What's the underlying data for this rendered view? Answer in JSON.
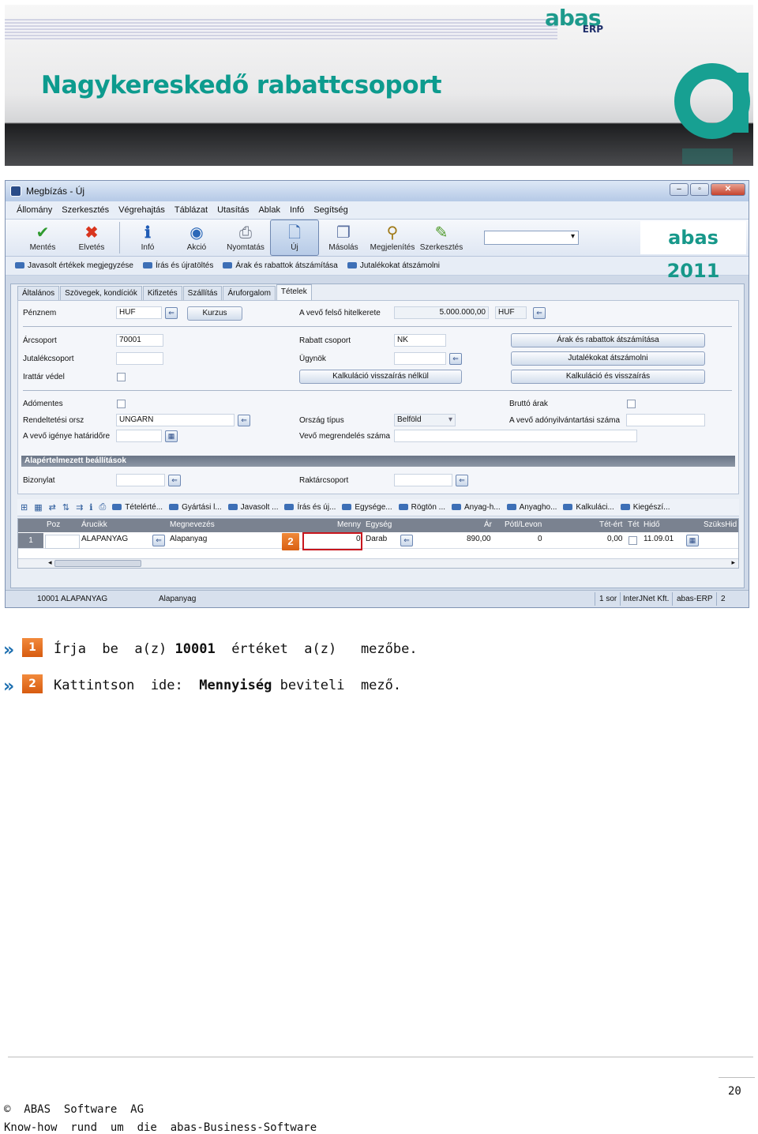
{
  "banner": {
    "title": "Nagykereskedő rabattcsoport",
    "logo_top": "abas",
    "logo_bottom": "ERP",
    "accent": "#0d9b8e"
  },
  "window": {
    "title": "Megbízás - Új",
    "menu": [
      "Állomány",
      "Szerkesztés",
      "Végrehajtás",
      "Táblázat",
      "Utasítás",
      "Ablak",
      "Infó",
      "Segítség"
    ],
    "toolbar": [
      {
        "label": "Mentés",
        "icon": "check-icon",
        "color": "#2f9a2f"
      },
      {
        "label": "Elvetés",
        "icon": "x-icon",
        "color": "#d9351e"
      },
      {
        "label": "Infó",
        "icon": "info-icon",
        "color": "#1f5bb5"
      },
      {
        "label": "Akció",
        "icon": "action-icon",
        "color": "#2b68b8"
      },
      {
        "label": "Nyomtatás",
        "icon": "printer-icon",
        "color": "#6f7786"
      },
      {
        "label": "Új",
        "icon": "new-doc-icon",
        "color": "#3567ad"
      },
      {
        "label": "Másolás",
        "icon": "copy-icon",
        "color": "#5a6fa0"
      },
      {
        "label": "Megjelenítés",
        "icon": "magnifier-icon",
        "color": "#a07a18"
      },
      {
        "label": "Szerkesztés",
        "icon": "edit-icon",
        "color": "#4f9a2a"
      }
    ],
    "version_label": "abas 2011",
    "action_links": [
      "Javasolt értékek megjegyzése",
      "Írás és újratöltés",
      "Árak és rabattok átszámítása",
      "Jutalékokat átszámolni"
    ],
    "tabs": [
      "Általános",
      "Szövegek, kondíciók",
      "Kifizetés",
      "Szállítás",
      "Áruforgalom",
      "Tételek"
    ],
    "active_tab": "Tételek",
    "form": {
      "penznem_label": "Pénznem",
      "penznem_value": "HUF",
      "kurzus_button": "Kurzus",
      "hitelkeret_label": "A vevő felső hitelkerete",
      "hitelkeret_value": "5.000.000,00",
      "hitelkeret_currency": "HUF",
      "arcsoport_label": "Árcsoport",
      "arcsoport_value": "70001",
      "rabatt_label": "Rabatt csoport",
      "rabatt_value": "NK",
      "arak_button": "Árak és rabattok átszámítása",
      "jutalekcsoport_label": "Jutalékcsoport",
      "ugynok_label": "Ügynök",
      "jutalek_button": "Jutalékokat átszámolni",
      "irattar_label": "Irattár védel",
      "kalk_nelkul_button": "Kalkuláció visszaírás nélkül",
      "kalk_button": "Kalkuláció és visszaírás",
      "adomentes_label": "Adómentes",
      "brutto_label": "Bruttó árak",
      "rendeltetesi_label": "Rendeltetési orsz",
      "rendeltetesi_value": "UNGARN",
      "orszag_label": "Ország típus",
      "orszag_value": "Belföld",
      "adonyilv_label": "A vevő adónyilvántartási száma",
      "igeny_label": "A vevő igénye határidőre",
      "megrendeles_label": "Vevő megrendelés száma",
      "section_title": "Alapértelmezett beállítások",
      "bizonylat_label": "Bizonylat",
      "raktar_label": "Raktárcsoport"
    },
    "grid_tools": [
      "Tételérté...",
      "Gyártási l...",
      "Javasolt ...",
      "Írás és új...",
      "Egysége...",
      "Rögtön ...",
      "Anyag-h...",
      "Anyagho...",
      "Kalkuláci...",
      "Kiegészí..."
    ],
    "grid": {
      "headers": [
        "Poz",
        "Árucikk",
        "Megnevezés",
        "Menny",
        "Egység",
        "Ár",
        "Pótl/Levon",
        "Tét-ért",
        "Tét",
        "Hidő",
        "SzüksHid"
      ],
      "row": {
        "no": "1",
        "arucikk": "ALAPANYAG",
        "megnevezes": "Alapanyag",
        "menny": "0",
        "egyseg": "Darab",
        "ar": "890,00",
        "potl": "0",
        "tetert": "0,00",
        "hido": "11.09.01"
      }
    },
    "marker": "2",
    "status": {
      "left": "10001 ALAPANYAG",
      "mid": "Alapanyag",
      "sor": "1 sor",
      "company": "InterJNet Kft.",
      "app": "abas-ERP",
      "num": "2"
    }
  },
  "instructions": [
    {
      "marker": "1",
      "parts": [
        "Írja  be  a(z) ",
        "10001",
        "  értéket  a(z)   mezőbe."
      ]
    },
    {
      "marker": "2",
      "parts": [
        "Kattintson  ide:  ",
        "Mennyiség",
        " beviteli  mező."
      ]
    }
  ],
  "footer": {
    "page": "20",
    "copyright": "©  ABAS  Software  AG",
    "tagline": "Know-how  rund  um  die  abas-Business-Software"
  }
}
